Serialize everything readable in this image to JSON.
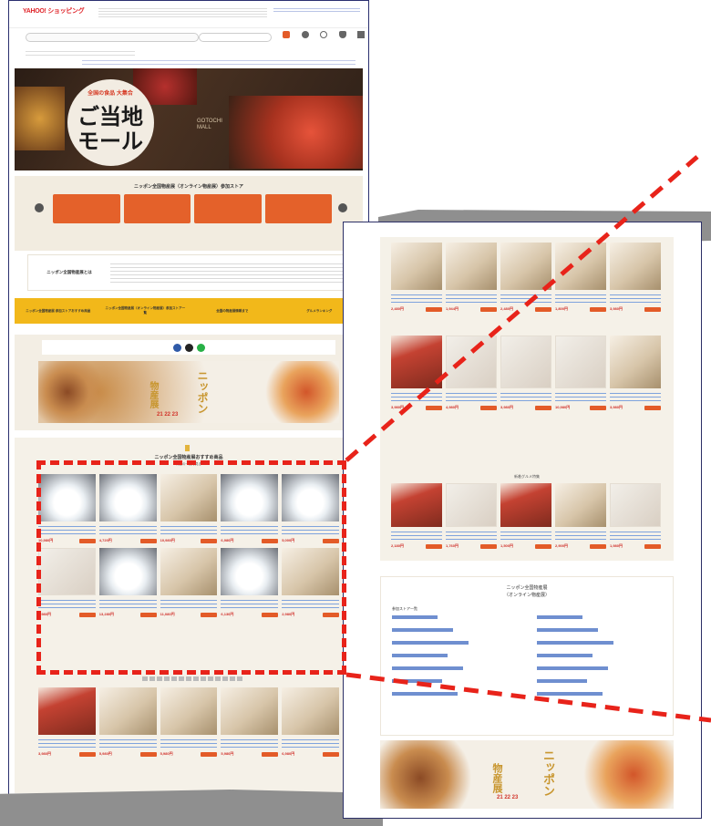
{
  "left_screenshot": {
    "header": {
      "logo": "YAHOO! ショッピング",
      "search_placeholder": "",
      "nav_items": [
        "",
        "",
        "",
        "",
        ""
      ]
    },
    "hero": {
      "title_line1": "ご当地",
      "title_line2": "モール",
      "subtitle": "全国の食品 大集合",
      "side_text": "GOTOCHI MALL"
    },
    "store_banner_title": "ニッポン全国物産展（オンライン物産展）参加ストア",
    "store_tiles": [
      "",
      "",
      "",
      ""
    ],
    "info_heading": "ニッポン全国物産展とは",
    "yellow_nav": [
      "ニッポン全国物産展 参加ストアおすすめ商品",
      "ニッポン全国物産展（オンライン物産展）参加ストア一覧",
      "全国の物産展情報まで",
      "グルメランキング"
    ],
    "banner": {
      "big_left": "物産展",
      "big_right": "ニッポン",
      "dates": "21 22 23"
    },
    "recommend": {
      "title": "ニッポン全国物産展おすすめ商品",
      "subtitle": "商品の一覧で見る",
      "products": [
        {
          "price": "10,980円"
        },
        {
          "price": "4,720円"
        },
        {
          "price": "10,980円"
        },
        {
          "price": "6,980円"
        },
        {
          "price": "5,000円"
        },
        {
          "price": "8,980円"
        },
        {
          "price": "13,280円"
        },
        {
          "price": "11,080円"
        },
        {
          "price": "6,130円"
        },
        {
          "price": "2,980円"
        }
      ]
    },
    "bottom_products": [
      {
        "price": "3,980円"
      },
      {
        "price": "5,980円"
      },
      {
        "price": "5,980円"
      },
      {
        "price": "5,980円"
      },
      {
        "price": "6,980円"
      }
    ]
  },
  "right_screenshot": {
    "rows_a": [
      {
        "price": "2,480円"
      },
      {
        "price": "1,944円"
      },
      {
        "price": "2,480円"
      },
      {
        "price": "1,800円"
      },
      {
        "price": "3,980円"
      }
    ],
    "rows_b": [
      {
        "price": "3,980円"
      },
      {
        "price": "4,980円"
      },
      {
        "price": "3,980円"
      },
      {
        "price": "10,980円"
      },
      {
        "price": "3,980円"
      }
    ],
    "section_label": "新着グルメ特集",
    "rows_c": [
      {
        "price": "2,180円"
      },
      {
        "price": "1,760円"
      },
      {
        "price": "1,500円"
      },
      {
        "price": "2,900円"
      },
      {
        "price": "1,980円"
      }
    ],
    "footer": {
      "title_line1": "ニッポン全国物産展",
      "title_line2": "（オンライン物産展）",
      "list_heading": "参加ストア一覧",
      "stores_left": [
        "",
        "",
        "",
        "",
        "",
        "",
        ""
      ],
      "stores_right": [
        "",
        "",
        "",
        "",
        "",
        "",
        ""
      ]
    },
    "banner": {
      "big_left": "物産展",
      "big_right": "ニッポン",
      "dates": "21 22 23"
    }
  },
  "colors": {
    "accent": "#e8231a",
    "brand": "#e35b28",
    "yellow": "#f2b81a",
    "frame": "#2a2f6f"
  }
}
